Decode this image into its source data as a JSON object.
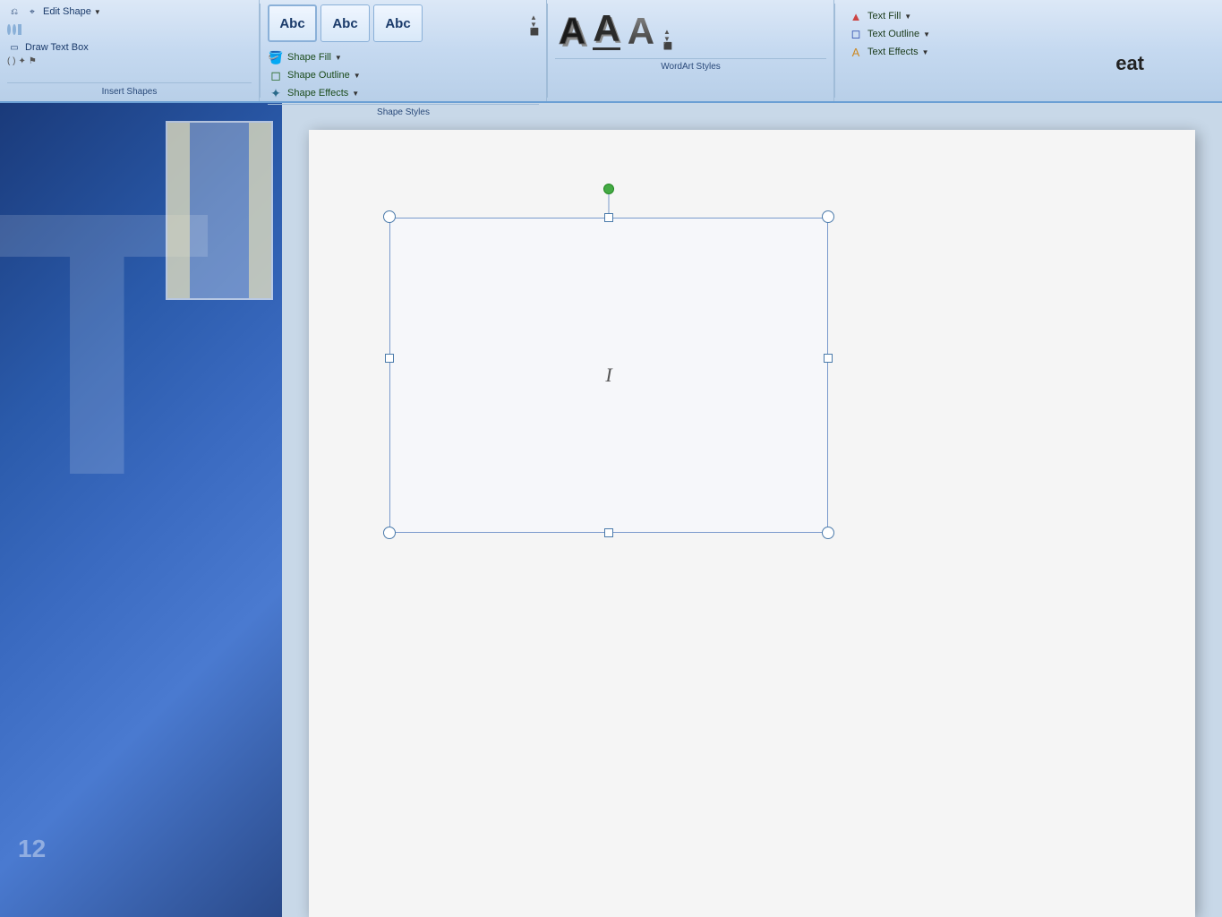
{
  "ribbon": {
    "sections": {
      "insert_shapes": {
        "label": "Insert Shapes",
        "edit_shape": "Edit Shape",
        "draw_text_box": "Draw Text Box"
      },
      "shape_styles": {
        "label": "Shape Styles",
        "abc_buttons": [
          "Abc",
          "Abc",
          "Abc"
        ],
        "shape_fill": "Shape Fill",
        "shape_outline": "Shape Outline",
        "shape_effects": "Shape Effects",
        "expand_icon": "⊡"
      },
      "wordart_styles": {
        "label": "WordArt Styles",
        "letters": [
          "A",
          "A",
          "A"
        ],
        "expand_icon": "⊡"
      },
      "text_fill": {
        "text_fill": "Text Fill",
        "text_outline": "Text Outline",
        "text_effects": "Text Effects"
      }
    }
  },
  "canvas": {
    "cursor_visible": true,
    "eat_label": "eat"
  },
  "sidebar": {
    "decoration_letter": "T"
  }
}
